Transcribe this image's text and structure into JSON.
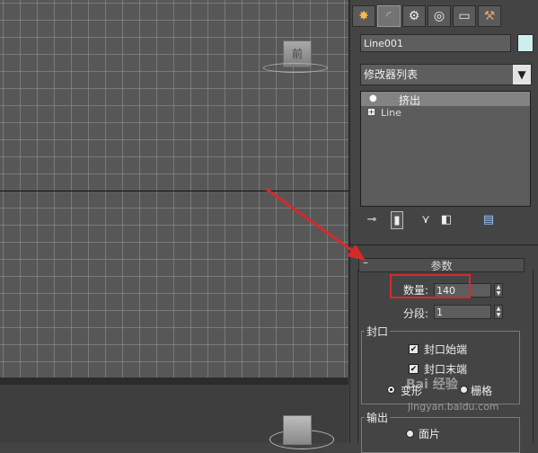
{
  "viewport": {
    "viewcube_label": "前"
  },
  "command_tabs": [
    {
      "icon": "create-icon",
      "glyph": "✸"
    },
    {
      "icon": "modify-icon",
      "glyph": "◜"
    },
    {
      "icon": "hierarchy-icon",
      "glyph": "⚙"
    },
    {
      "icon": "motion-icon",
      "glyph": "◎"
    },
    {
      "icon": "display-icon",
      "glyph": "▭"
    },
    {
      "icon": "utilities-icon",
      "glyph": "⚒"
    }
  ],
  "object": {
    "name": "Line001",
    "color": "#cdeff0"
  },
  "modifier_list": {
    "label": "修改器列表"
  },
  "stack": [
    {
      "label": "挤出"
    },
    {
      "label": "Line"
    }
  ],
  "parameters": {
    "title": "参数",
    "collapse": "–",
    "amount_label": "数量:",
    "amount_value": "140",
    "segments_label": "分段:",
    "segments_value": "1",
    "capping": {
      "title": "封口",
      "cap_start": "封口始端",
      "cap_end": "封口末端",
      "morph": "变形",
      "grid": "栅格"
    },
    "output": {
      "title": "输出",
      "patch": "面片"
    }
  },
  "watermark": {
    "line1": "Bai 经验",
    "line2": "jingyan.baidu.com"
  },
  "annotation_color": "#d42a2a"
}
